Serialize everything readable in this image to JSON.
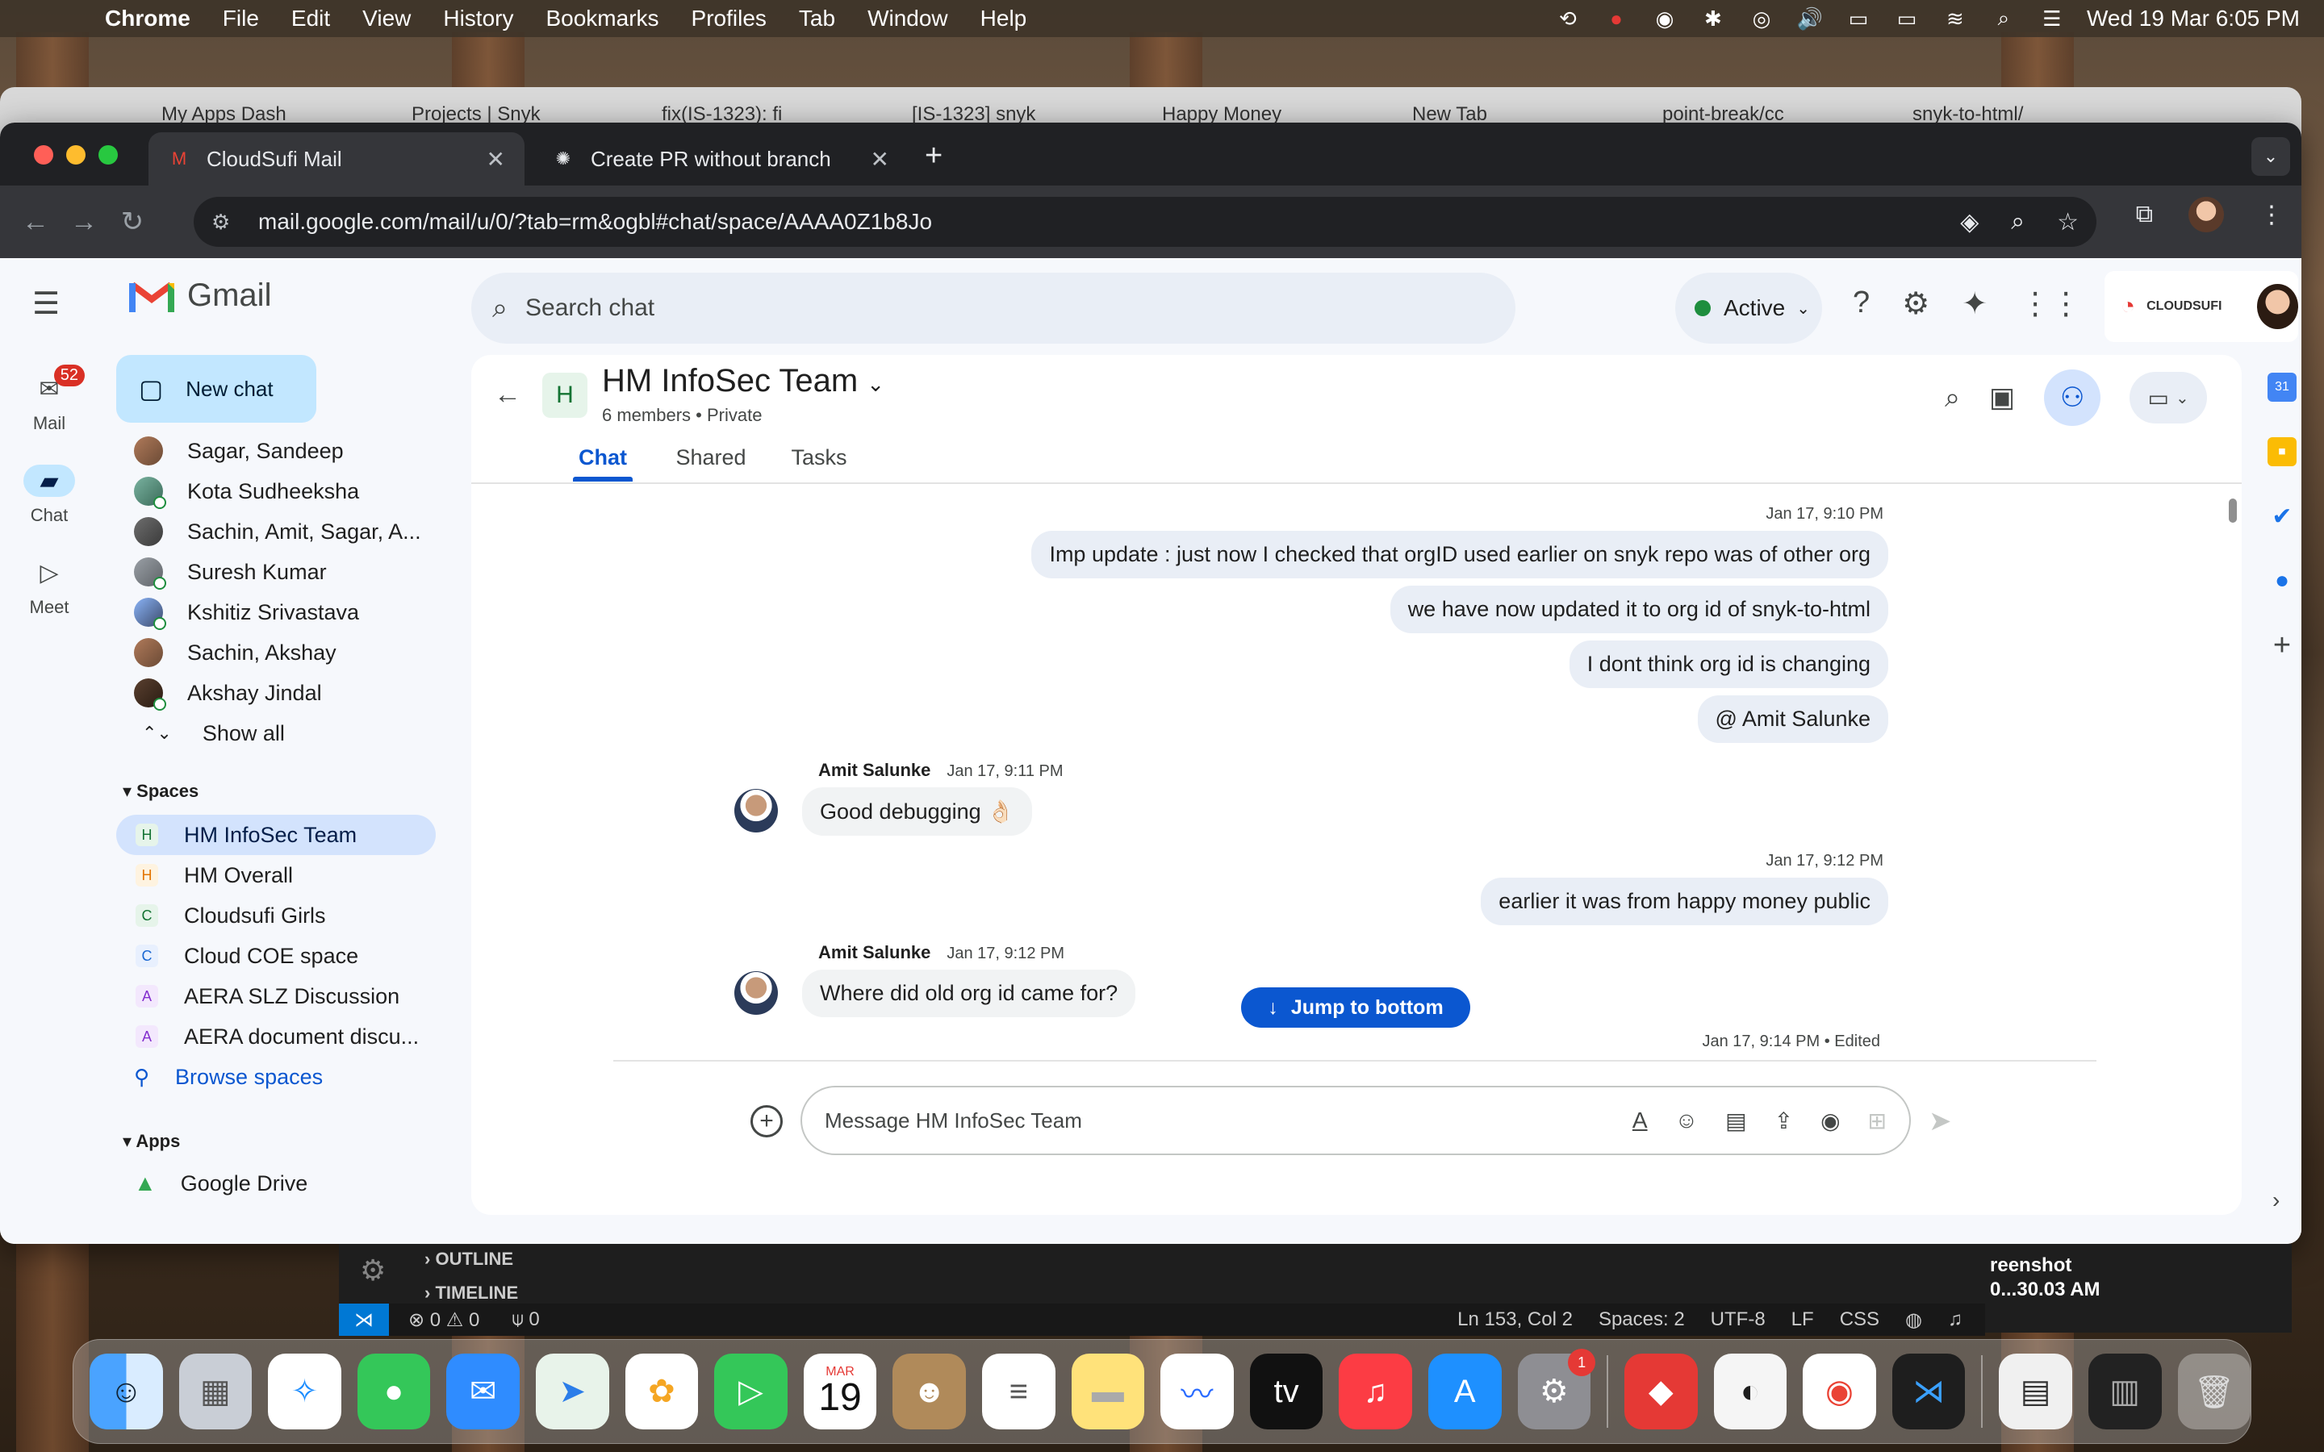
{
  "menubar": {
    "app": "Chrome",
    "items": [
      "File",
      "Edit",
      "View",
      "History",
      "Bookmarks",
      "Profiles",
      "Tab",
      "Window",
      "Help"
    ],
    "clock": "Wed 19 Mar  6:05 PM"
  },
  "back_tabs": [
    "My Apps Dash",
    "Projects | Snyk",
    "fix(IS-1323): fi",
    "[IS-1323] snyk",
    "Happy Money",
    "New Tab",
    "point-break/cc",
    "snyk-to-html/"
  ],
  "tabs": [
    {
      "title": "CloudSufi Mail",
      "active": true
    },
    {
      "title": "Create PR without branch",
      "active": false
    }
  ],
  "url": "mail.google.com/mail/u/0/?tab=rm&ogbl#chat/space/AAAA0Z1b8Jo",
  "gmail": {
    "brand": "Gmail",
    "search_placeholder": "Search chat",
    "status": "Active",
    "company": "CLOUDSUFI"
  },
  "rail": {
    "mail": "Mail",
    "mail_badge": "52",
    "chat": "Chat",
    "meet": "Meet"
  },
  "nav": {
    "new_chat": "New chat",
    "dms": [
      "Sagar, Sandeep",
      "Kota Sudheeksha",
      "Sachin, Amit, Sagar, A...",
      "Suresh Kumar",
      "Kshitiz Srivastava",
      "Sachin, Akshay",
      "Akshay Jindal"
    ],
    "show_all": "Show all",
    "spaces_header": "Spaces",
    "spaces": [
      {
        "letter": "H",
        "name": "HM InfoSec Team",
        "color": "#e6f4ea",
        "fg": "#137333"
      },
      {
        "letter": "H",
        "name": "HM Overall",
        "color": "#fef3e0",
        "fg": "#e37400"
      },
      {
        "letter": "C",
        "name": "Cloudsufi Girls",
        "color": "#e6f4ea",
        "fg": "#137333"
      },
      {
        "letter": "C",
        "name": "Cloud COE space",
        "color": "#e8f0fe",
        "fg": "#1967d2"
      },
      {
        "letter": "A",
        "name": "AERA SLZ Discussion",
        "color": "#f3e8fd",
        "fg": "#8430ce"
      },
      {
        "letter": "A",
        "name": "AERA document discu...",
        "color": "#f3e8fd",
        "fg": "#8430ce"
      }
    ],
    "browse": "Browse spaces",
    "apps_header": "Apps",
    "apps": [
      "Google Drive"
    ]
  },
  "chat": {
    "space_letter": "H",
    "title": "HM InfoSec Team",
    "members": "6 members",
    "privacy": "Private",
    "tabs": [
      "Chat",
      "Shared",
      "Tasks"
    ],
    "messages": {
      "ts1": "Jan 17, 9:10 PM",
      "m1": "Imp update : just now I checked that orgID used earlier on snyk repo was of other org",
      "m2": "we have now updated it to org id of snyk-to-html",
      "m3": "I dont think org id is changing",
      "m4": "@ Amit Salunke",
      "s1_name": "Amit Salunke",
      "s1_time": "Jan 17, 9:11 PM",
      "m5": "Good debugging 👌🏻",
      "ts2": "Jan 17, 9:12 PM",
      "m6": "earlier it was from happy money public",
      "s2_name": "Amit Salunke",
      "s2_time": "Jan 17, 9:12 PM",
      "m7": "Where did old org id came for?",
      "ts3": "Jan 17, 9:14 PM",
      "edited": "Edited"
    },
    "jump": "Jump to bottom",
    "composer_placeholder": "Message HM InfoSec Team"
  },
  "vscode": {
    "outline": "OUTLINE",
    "timeline": "TIMELINE",
    "problems": "⊗ 0 ⚠ 0",
    "ports": "0",
    "position": "Ln 153, Col 2",
    "spaces": "Spaces: 2",
    "encoding": "UTF-8",
    "eol": "LF",
    "lang": "CSS"
  },
  "desktop": {
    "screenshot_label_1": "reenshot",
    "screenshot_label_2": "0...30.03 AM"
  },
  "dock": {
    "calendar_month": "MAR",
    "calendar_day": "19",
    "settings_badge": "1"
  }
}
